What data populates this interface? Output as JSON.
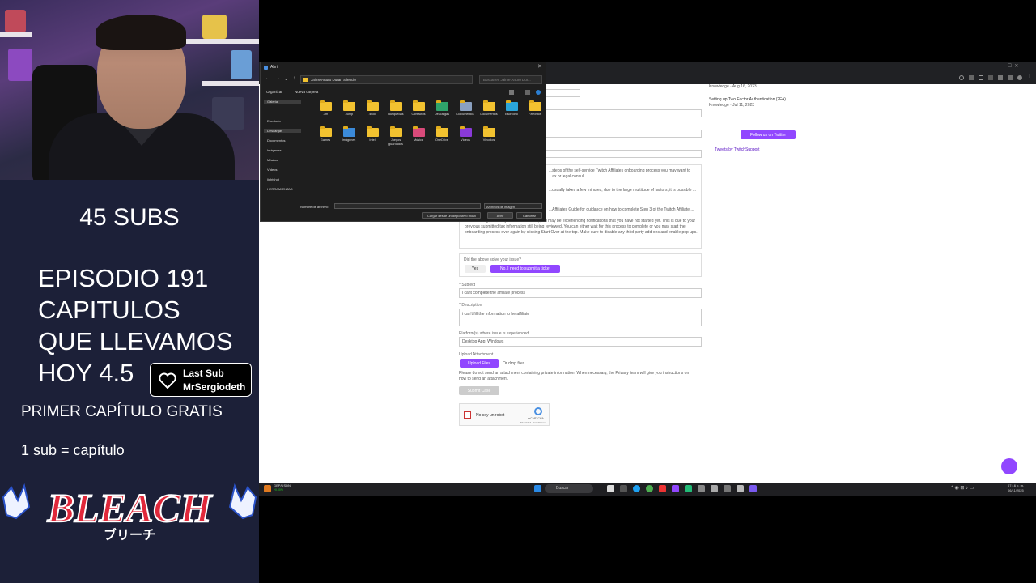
{
  "overlay": {
    "subs": "45 SUBS",
    "episode_lines": "EPISODIO 191\nCAPITULOS\nQUE LLEVAMOS\nHOY 4.5",
    "last_sub_label": "Last Sub",
    "last_sub_user": "MrSergiodeth",
    "primer": "PRIMER CAPÍTULO GRATIS",
    "rule": "1 sub = capítulo",
    "logo_text": "BLEACH",
    "logo_sub": "ブリーチ"
  },
  "dialog": {
    "title": "Abrir",
    "address": "Jaime Arturo Duran Silencio",
    "search_placeholder": "Buscar en Jaime Arturo Dur...",
    "organize": "Organizar",
    "new_folder": "Nueva carpeta",
    "sidebar": [
      "Galería",
      "Escritorio",
      "Descargas",
      "Documentos",
      "Imágenes",
      "Música",
      "Vídeos",
      "lightshot",
      "HERRAMIENTAS"
    ],
    "folders_row1": [
      ".3m",
      ".Jump",
      ".ssod",
      "Búsquedas",
      "Contactos",
      "Descargas",
      "Documentos",
      "Documentos",
      "Escritorio",
      "Favoritos"
    ],
    "folders_row2": [
      "Games",
      "Imágenes",
      "Intel",
      "Juegos guardados",
      "Música",
      "OneDrive",
      "Vídeos",
      "Vínculos"
    ],
    "filename_label": "Nombre de archivo:",
    "filetype": "Archivos de imagen",
    "load_device": "Cargar desde un dispositivo móvil",
    "open": "Abrir",
    "cancel": "Cancelar"
  },
  "page": {
    "kb_item1": "Knowledge · Aug 16, 2023",
    "kb_item2_title": "Setting up Two Factor Authentication (2FA)",
    "kb_item2_meta": "Knowledge · Jul 11, 2023",
    "follow_button": "Follow us on Twitter",
    "tweets_link": "Tweets by TwitchSupport",
    "info_p1": "...steps of the self-service Twitch Affiliates onboarding process you may want to ...ax or legal consul.",
    "info_p2": "...usually takes a few minutes, due to the large multitude of factors, it is possible ...",
    "info_p3": "...Affiliates Guide for guidance on how to complete Step 3 of the Twitch Affiliate ...",
    "info_p4": "...onboarding process you have restarted, you may be experiencing notifications that you have not started yet. This is due to your previous submitted tax information still being reviewed. You can either wait for this process to complete or you may start the onboarding process over again by clicking Start Over at the top. Make sure to disable any third party add-ons and enable pop ups.",
    "solve_question": "Did the above solve your issue?",
    "yes": "Yes",
    "no_ticket": "No, I need to submit a ticket",
    "subject_label": "* Subject",
    "subject_value": "i cant complete the affiliate process",
    "description_label": "* Description",
    "description_value": "i can't fill the information to be affiliate",
    "platform_label": "Platform(s) where issue is experienced",
    "platform_value": "Desktop App: Windows",
    "upload_label": "Upload Attachment",
    "upload_button": "Upload Files",
    "drop_files": "Or drop files",
    "privacy_note": "Please do not send an attachment containing private information. When necessary, the Privacy team will give you instructions on how to send an attachment.",
    "submit": "Submit Case",
    "captcha": "No soy un robot",
    "captcha_brand": "reCAPTCHA",
    "captcha_terms": "Privacidad - Condiciones"
  },
  "taskbar": {
    "weather": "GBP/USDN",
    "weather_sub": "+0.00%",
    "search": "Buscar",
    "time": "07:16 p. m.",
    "date": "06/11/2025"
  }
}
